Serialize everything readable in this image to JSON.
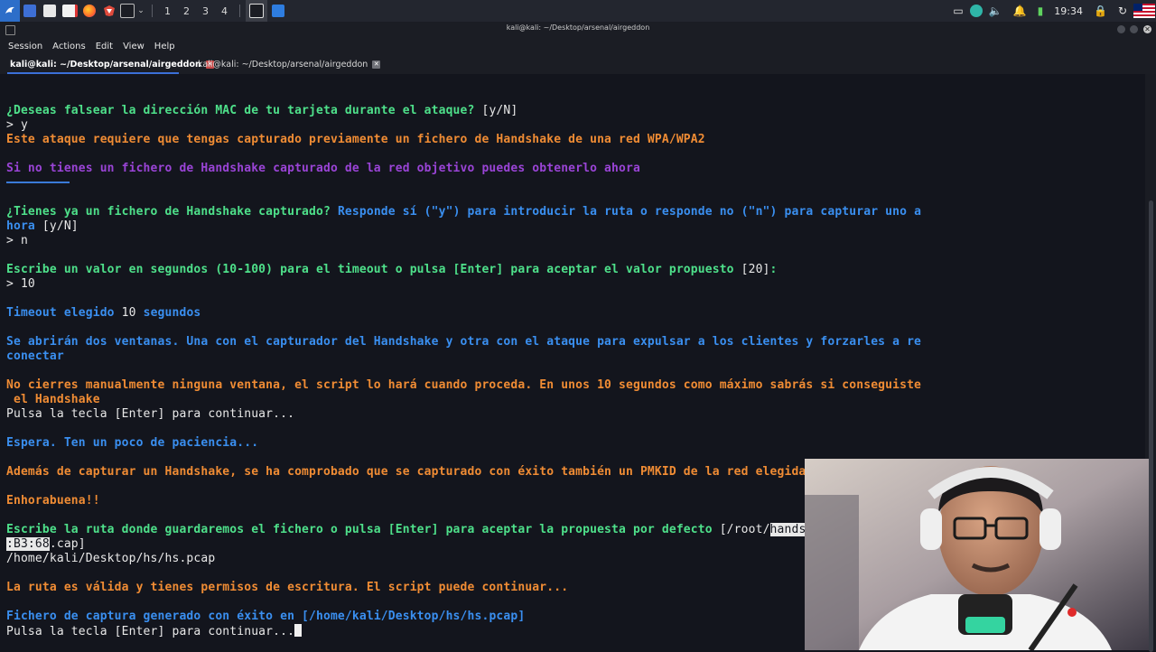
{
  "panel": {
    "workspaces": [
      "1",
      "2",
      "3",
      "4"
    ],
    "clock": "19:34",
    "icons": [
      "kali-menu-icon",
      "desktop-icon",
      "files-icon",
      "text-editor-icon",
      "firefox-icon",
      "burp-icon",
      "terminal-icon",
      "chevron-down-icon",
      "terminal-task-icon",
      "folder-task-icon",
      "display-icon",
      "tray-app-icon",
      "volume-icon",
      "bell-icon",
      "battery-icon",
      "lock-icon",
      "refresh-icon",
      "us-flag-icon"
    ]
  },
  "window": {
    "title": "kali@kali: ~/Desktop/arsenal/airgeddon"
  },
  "menu": [
    "Session",
    "Actions",
    "Edit",
    "View",
    "Help"
  ],
  "tabs": [
    {
      "label": "kali@kali: ~/Desktop/arsenal/airgeddon"
    },
    {
      "label": "kali@kali: ~/Desktop/arsenal/airgeddon"
    }
  ],
  "terminal": {
    "l1": "¿Deseas falsear la dirección MAC de tu tarjeta durante el ataque? ",
    "l1b": "[y/N]",
    "l2": "> y",
    "l3": "Este ataque requiere que tengas capturado previamente un fichero de Handshake de una red WPA/WPA2",
    "l4": "Si no tienes un fichero de Handshake capturado de la red objetivo puedes obtenerlo ahora",
    "l5a": "¿Tienes ya un fichero de Handshake capturado? ",
    "l5b": "Responde sí (\"y\") para introducir la ruta o responde no (\"n\") para capturar uno a",
    "l6a": "hora",
    "l6b": " [y/N]",
    "l7": "> n",
    "l8a": "Escribe un valor en segundos (10-100) para el timeout o pulsa [Enter] para aceptar el valor propuesto ",
    "l8b": "[20]",
    "l8c": ":",
    "l9": "> 10",
    "l10a": "Timeout elegido ",
    "l10b": "10",
    "l10c": " segundos",
    "l11": "Se abrirán dos ventanas. Una con el capturador del Handshake y otra con el ataque para expulsar a los clientes y forzarles a re",
    "l12": "conectar",
    "l13": "No cierres manualmente ninguna ventana, el script lo hará cuando proceda. En unos 10 segundos como máximo sabrás si conseguiste",
    "l14": " el Handshake",
    "l15": "Pulsa la tecla [Enter] para continuar...",
    "l16": "Espera. Ten un poco de paciencia...",
    "l17": "Además de capturar un Handshake, se ha comprobado que se capturado con éxito también un PMKID de la red elegida",
    "l18": "Enhorabuena!!",
    "l19a": "Escribe la ruta donde guardaremos el fichero o pulsa [Enter] para aceptar la propuesta por defecto ",
    "l19b": "[/root/",
    "l19c": "hands",
    "l20a": ":B3:68",
    "l20b": ".cap]",
    "l21": "/home/kali/Desktop/hs/hs.pcap",
    "l22": "La ruta es válida y tienes permisos de escritura. El script puede continuar...",
    "l23a": "Fichero de captura generado con éxito en ",
    "l23b": "[/home/kali/Desktop/hs/hs.pcap]",
    "l24": "Pulsa la tecla [Enter] para continuar..."
  }
}
